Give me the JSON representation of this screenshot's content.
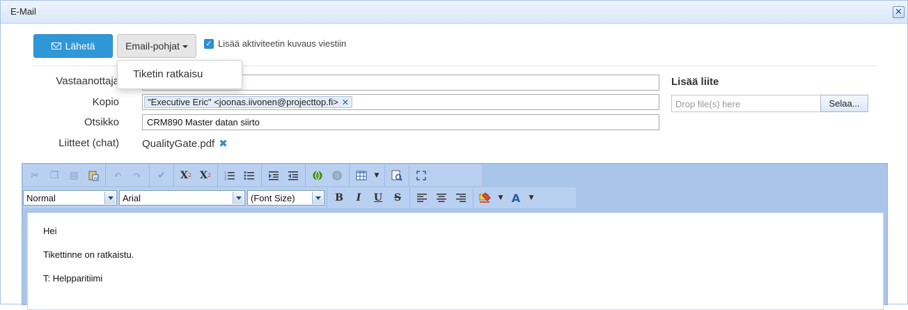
{
  "window": {
    "title": "E-Mail"
  },
  "toolbar": {
    "send_label": "Lähetä",
    "templates_label": "Email-pohjat",
    "add_description_label": "Lisää aktiviteetin kuvaus viestiin",
    "add_description_checked": true
  },
  "templates_menu": {
    "items": [
      "Tiketin ratkaisu"
    ]
  },
  "form": {
    "recipient_label": "Vastaanottaja",
    "recipient_value": "",
    "copy_label": "Kopio",
    "copy_tags": [
      "\"Executive Eric\" <joonas.iivonen@projecttop.fi>"
    ],
    "subject_label": "Otsikko",
    "subject_value": "CRM890 Master datan siirto",
    "attachments_label": "Liitteet (chat)",
    "attachments": [
      "QualityGate.pdf"
    ]
  },
  "attachment_panel": {
    "title": "Lisää liite",
    "drop_placeholder": "Drop file(s) here",
    "browse_label": "Selaa..."
  },
  "editor": {
    "format_value": "Normal",
    "font_value": "Arial",
    "size_value": "(Font Size)",
    "body_lines": [
      "Hei",
      "Tikettinne on ratkaistu.",
      "T: Helpparitiimi"
    ]
  },
  "colors": {
    "accent": "#2f97d8",
    "titlebar": "#dce9f9",
    "editor_toolbar": "#b9d0f0"
  }
}
